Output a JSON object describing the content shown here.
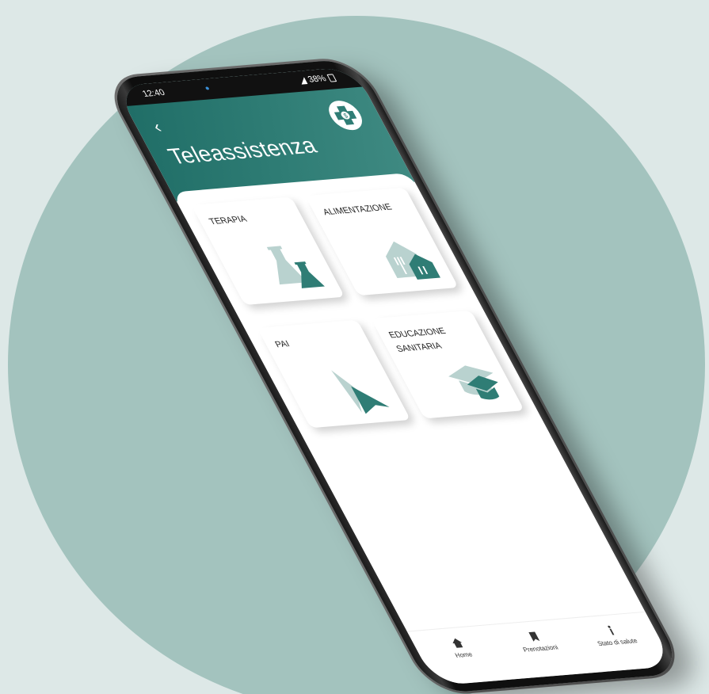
{
  "status_bar": {
    "time": "12:40",
    "battery": "38%"
  },
  "header": {
    "back_icon": "chevron-left-icon",
    "title": "Teleassistenza",
    "logo_icon": "medical-cross-logo-icon"
  },
  "tiles": [
    {
      "label": "TERAPIA",
      "icon": "flask-icon"
    },
    {
      "label": "ALIMENTAZIONE",
      "icon": "house-fork-icon"
    },
    {
      "label": "PAI",
      "icon": "arrow-cursor-icon"
    },
    {
      "label": "EDUCAZIONE SANITARIA",
      "icon": "graduation-cap-icon"
    }
  ],
  "bottom_nav": [
    {
      "label": "Home",
      "icon": "home-icon"
    },
    {
      "label": "Prenotazioni",
      "icon": "bookmark-icon"
    },
    {
      "label": "Stato di salute",
      "icon": "info-icon"
    }
  ],
  "colors": {
    "accent": "#2f7d75",
    "accent_light": "#b9d2cf",
    "background_circle": "#a3c3be",
    "background": "#dde8e7"
  }
}
